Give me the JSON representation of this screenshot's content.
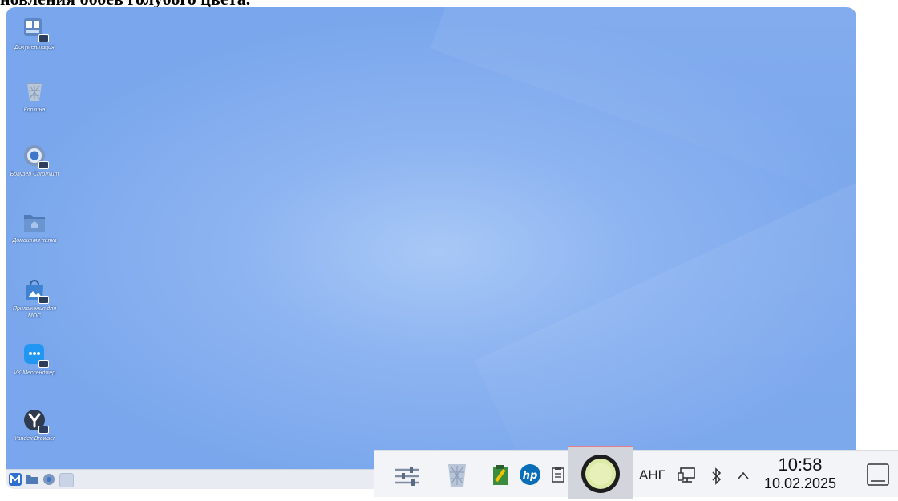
{
  "caption": "новления обоев голубого цвета.",
  "desktop_icons": [
    {
      "label": "Документация",
      "icon": "documents-icon"
    },
    {
      "label": "Корзина",
      "icon": "trash-icon"
    },
    {
      "label": "Браузер Chromium",
      "icon": "chromium-icon"
    },
    {
      "label": "Домашняя папка",
      "icon": "home-folder-icon"
    },
    {
      "label": "Приложения для МОС",
      "icon": "app-store-icon"
    },
    {
      "label": "VK Мессенджер",
      "icon": "vk-messenger-icon"
    },
    {
      "label": "Yandex Browser",
      "icon": "yandex-browser-icon"
    }
  ],
  "tray": {
    "language": "АНГ",
    "time": "10:58",
    "date": "10.02.2025"
  },
  "colors": {
    "desktop": "#8db4f1",
    "tray_bg": "#f2f4f7",
    "active_indicator": "#e87c8a"
  }
}
